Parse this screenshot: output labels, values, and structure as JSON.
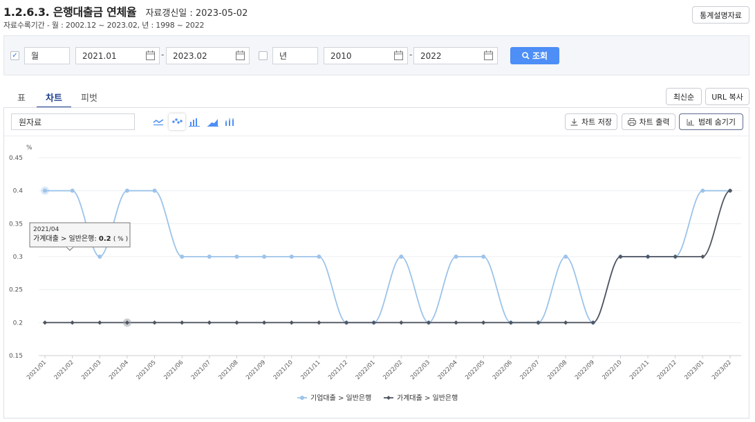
{
  "header": {
    "title": "1.2.6.3. 은행대출금 연체율",
    "updated": "자료갱신일 : 2023-05-02",
    "period": "자료수록기간 - 월 : 2002.12 ~ 2023.02, 년 : 1998 ~ 2022",
    "stats_button": "통계설명자료"
  },
  "filter": {
    "monthly_checked": true,
    "monthly_label": "월",
    "monthly_from": "2021.01",
    "monthly_to": "2023.02",
    "yearly_checked": false,
    "yearly_label": "년",
    "yearly_from": "2010",
    "yearly_to": "2022",
    "search_label": "조회",
    "dash": "-"
  },
  "tabs": [
    {
      "label": "표",
      "active": false
    },
    {
      "label": "차트",
      "active": true
    },
    {
      "label": "피벗",
      "active": false
    }
  ],
  "right_buttons": {
    "latest": "최신순",
    "url_copy": "URL 복사"
  },
  "chart_toolbar": {
    "data_select": "원자료",
    "save": "차트 저장",
    "print": "차트 출력",
    "legend_toggle": "범례 숨기기",
    "chart_types": [
      "line-chart-icon",
      "scatter-chart-icon",
      "bar-chart-icon",
      "area-chart-icon",
      "stacked-bar-chart-icon"
    ],
    "active_type": "scatter-chart-icon"
  },
  "tooltip": {
    "date": "2021/04",
    "series": "가계대출 > 일반은행",
    "value": "0.2",
    "unit": "( % )"
  },
  "colors": {
    "series1": "#9cc3ea",
    "series2": "#4f5560",
    "accent": "#4d8ef7"
  },
  "chart_data": {
    "type": "line",
    "unit_label": "%",
    "ylim": [
      0.15,
      0.45
    ],
    "y_ticks": [
      "0.15",
      "0.2",
      "0.25",
      "0.3",
      "0.35",
      "0.4",
      "0.45"
    ],
    "categories": [
      "2021/01",
      "2021/02",
      "2021/03",
      "2021/04",
      "2021/05",
      "2021/06",
      "2021/07",
      "2021/08",
      "2021/09",
      "2021/10",
      "2021/11",
      "2021/12",
      "2022/01",
      "2022/02",
      "2022/03",
      "2022/04",
      "2022/05",
      "2022/06",
      "2022/07",
      "2022/08",
      "2022/09",
      "2022/10",
      "2022/11",
      "2022/12",
      "2023/01",
      "2023/02"
    ],
    "series": [
      {
        "name": "기업대출 > 일반은행",
        "values": [
          0.4,
          0.4,
          0.3,
          0.4,
          0.4,
          0.3,
          0.3,
          0.3,
          0.3,
          0.3,
          0.3,
          0.2,
          0.2,
          0.3,
          0.2,
          0.3,
          0.3,
          0.2,
          0.2,
          0.3,
          0.2,
          0.3,
          0.3,
          0.3,
          0.4,
          0.4
        ]
      },
      {
        "name": "가계대출 > 일반은행",
        "values": [
          0.2,
          0.2,
          0.2,
          0.2,
          0.2,
          0.2,
          0.2,
          0.2,
          0.2,
          0.2,
          0.2,
          0.2,
          0.2,
          0.2,
          0.2,
          0.2,
          0.2,
          0.2,
          0.2,
          0.2,
          0.2,
          0.3,
          0.3,
          0.3,
          0.3,
          0.4
        ]
      }
    ],
    "grid": true,
    "legend": "bottom-center"
  }
}
